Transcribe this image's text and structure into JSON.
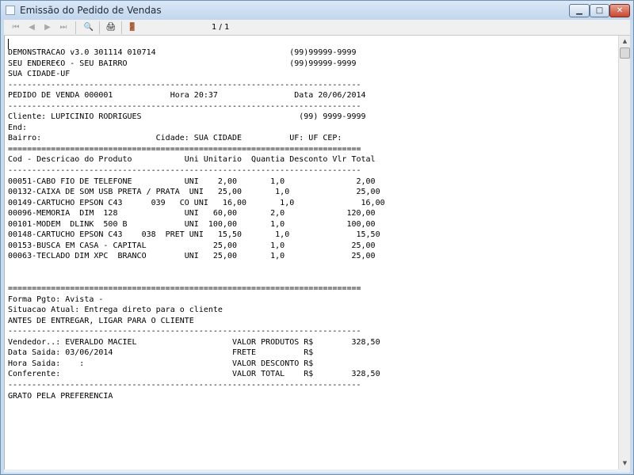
{
  "window": {
    "title": "Emissão do Pedido de Vendas"
  },
  "toolbar": {
    "first_icon": "⏮",
    "prev_icon": "◀",
    "next_icon": "▶",
    "last_icon": "⏭",
    "search_icon": "🔍",
    "print_icon": "🖨",
    "exit_icon": "🚪",
    "page_indicator": "1 / 1"
  },
  "report": {
    "lines": [
      "DEMONSTRACAO v3.0 301114 010714                            (99)99999-9999",
      "SEU ENDERE€O - SEU BAIRRO                                  (99)99999-9999",
      "SUA CIDADE-UF",
      "--------------------------------------------------------------------------",
      "PEDIDO DE VENDA 000001            Hora 20:37                Data 20/06/2014",
      "--------------------------------------------------------------------------",
      "Cliente: LUPICINIO RODRIGUES                                 (99) 9999-9999",
      "End:",
      "Bairro:                        Cidade: SUA CIDADE          UF: UF CEP:",
      "==========================================================================",
      "Cod - Descricao do Produto           Uni Unitario  Quantia Desconto Vlr Total",
      "--------------------------------------------------------------------------",
      "00051-CABO FIO DE TELEFONE           UNI    2,00       1,0               2,00",
      "00132-CAIXA DE SOM USB PRETA / PRATA  UNI   25,00       1,0              25,00",
      "00149-CARTUCHO EPSON C43      039   CO UNI   16,00       1,0              16,00",
      "00096-MEMORIA  DIM  128              UNI   60,00       2,0             120,00",
      "00101-MODEM  DLINK  500 B            UNI  100,00       1,0             100,00",
      "00148-CARTUCHO EPSON C43    038  PRET UNI   15,50       1,0              15,50",
      "00153-BUSCA EM CASA - CAPITAL              25,00       1,0              25,00",
      "00063-TECLADO DIM XPC  BRANCO        UNI   25,00       1,0              25,00",
      "",
      "",
      "==========================================================================",
      "Forma Pgto: Avista -",
      "Situacao Atual: Entrega direto para o cliente",
      "ANTES DE ENTREGAR, LIGAR PARA O CLIENTE",
      "--------------------------------------------------------------------------",
      "Vendedor..: EVERALDO MACIEL                    VALOR PRODUTOS R$        328,50",
      "Data Saida: 03/06/2014                         FRETE          R$",
      "Hora Saida:    :                               VALOR DESCONTO R$",
      "Conferente:                                    VALOR TOTAL    R$        328,50",
      "--------------------------------------------------------------------------",
      "GRATO PELA PREFERENCIA"
    ]
  }
}
